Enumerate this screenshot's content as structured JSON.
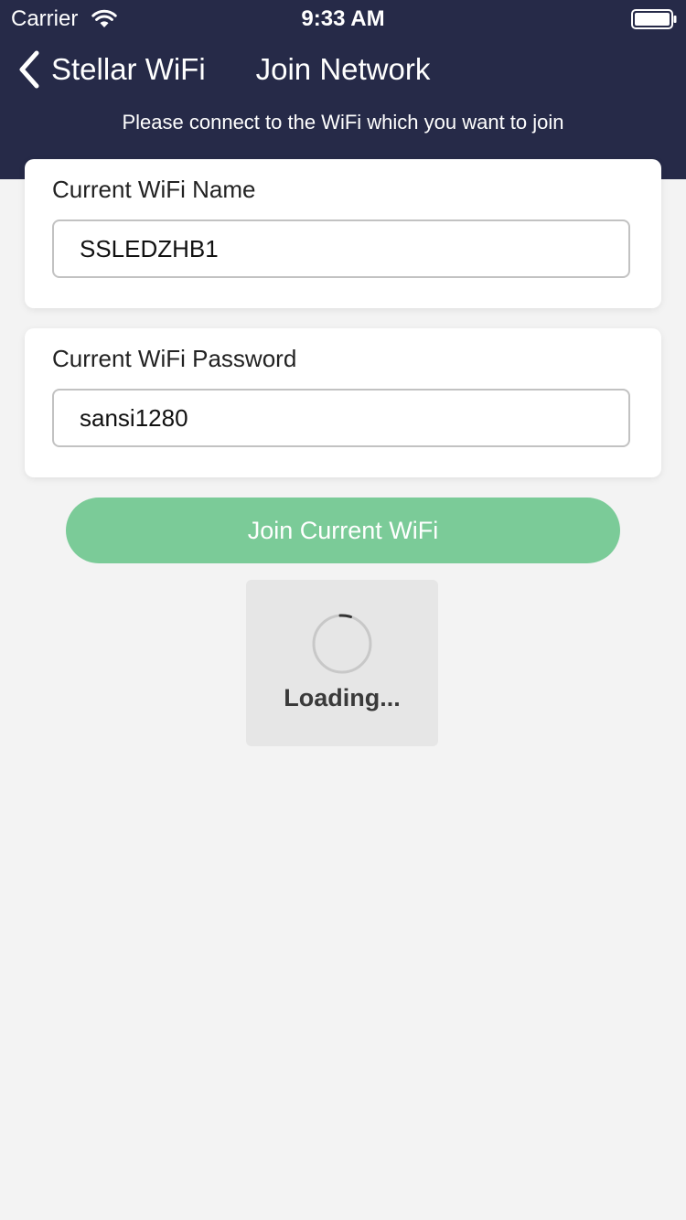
{
  "status_bar": {
    "carrier": "Carrier",
    "time": "9:33 AM",
    "icons": [
      "wifi-icon",
      "battery-icon"
    ]
  },
  "nav": {
    "back_label": "Stellar WiFi",
    "title": "Join Network",
    "subtitle": "Please connect to the WiFi which you want to join"
  },
  "form": {
    "wifi_name_label": "Current WiFi Name",
    "wifi_name_value": "SSLEDZHB1",
    "wifi_password_label": "Current WiFi Password",
    "wifi_password_value": "sansi1280",
    "join_button_label": "Join Current WiFi"
  },
  "loading": {
    "label": "Loading..."
  },
  "colors": {
    "header_bg": "#262a48",
    "page_bg": "#f3f3f3",
    "button_green": "#7bcb98",
    "hud_bg": "#e6e6e6"
  }
}
